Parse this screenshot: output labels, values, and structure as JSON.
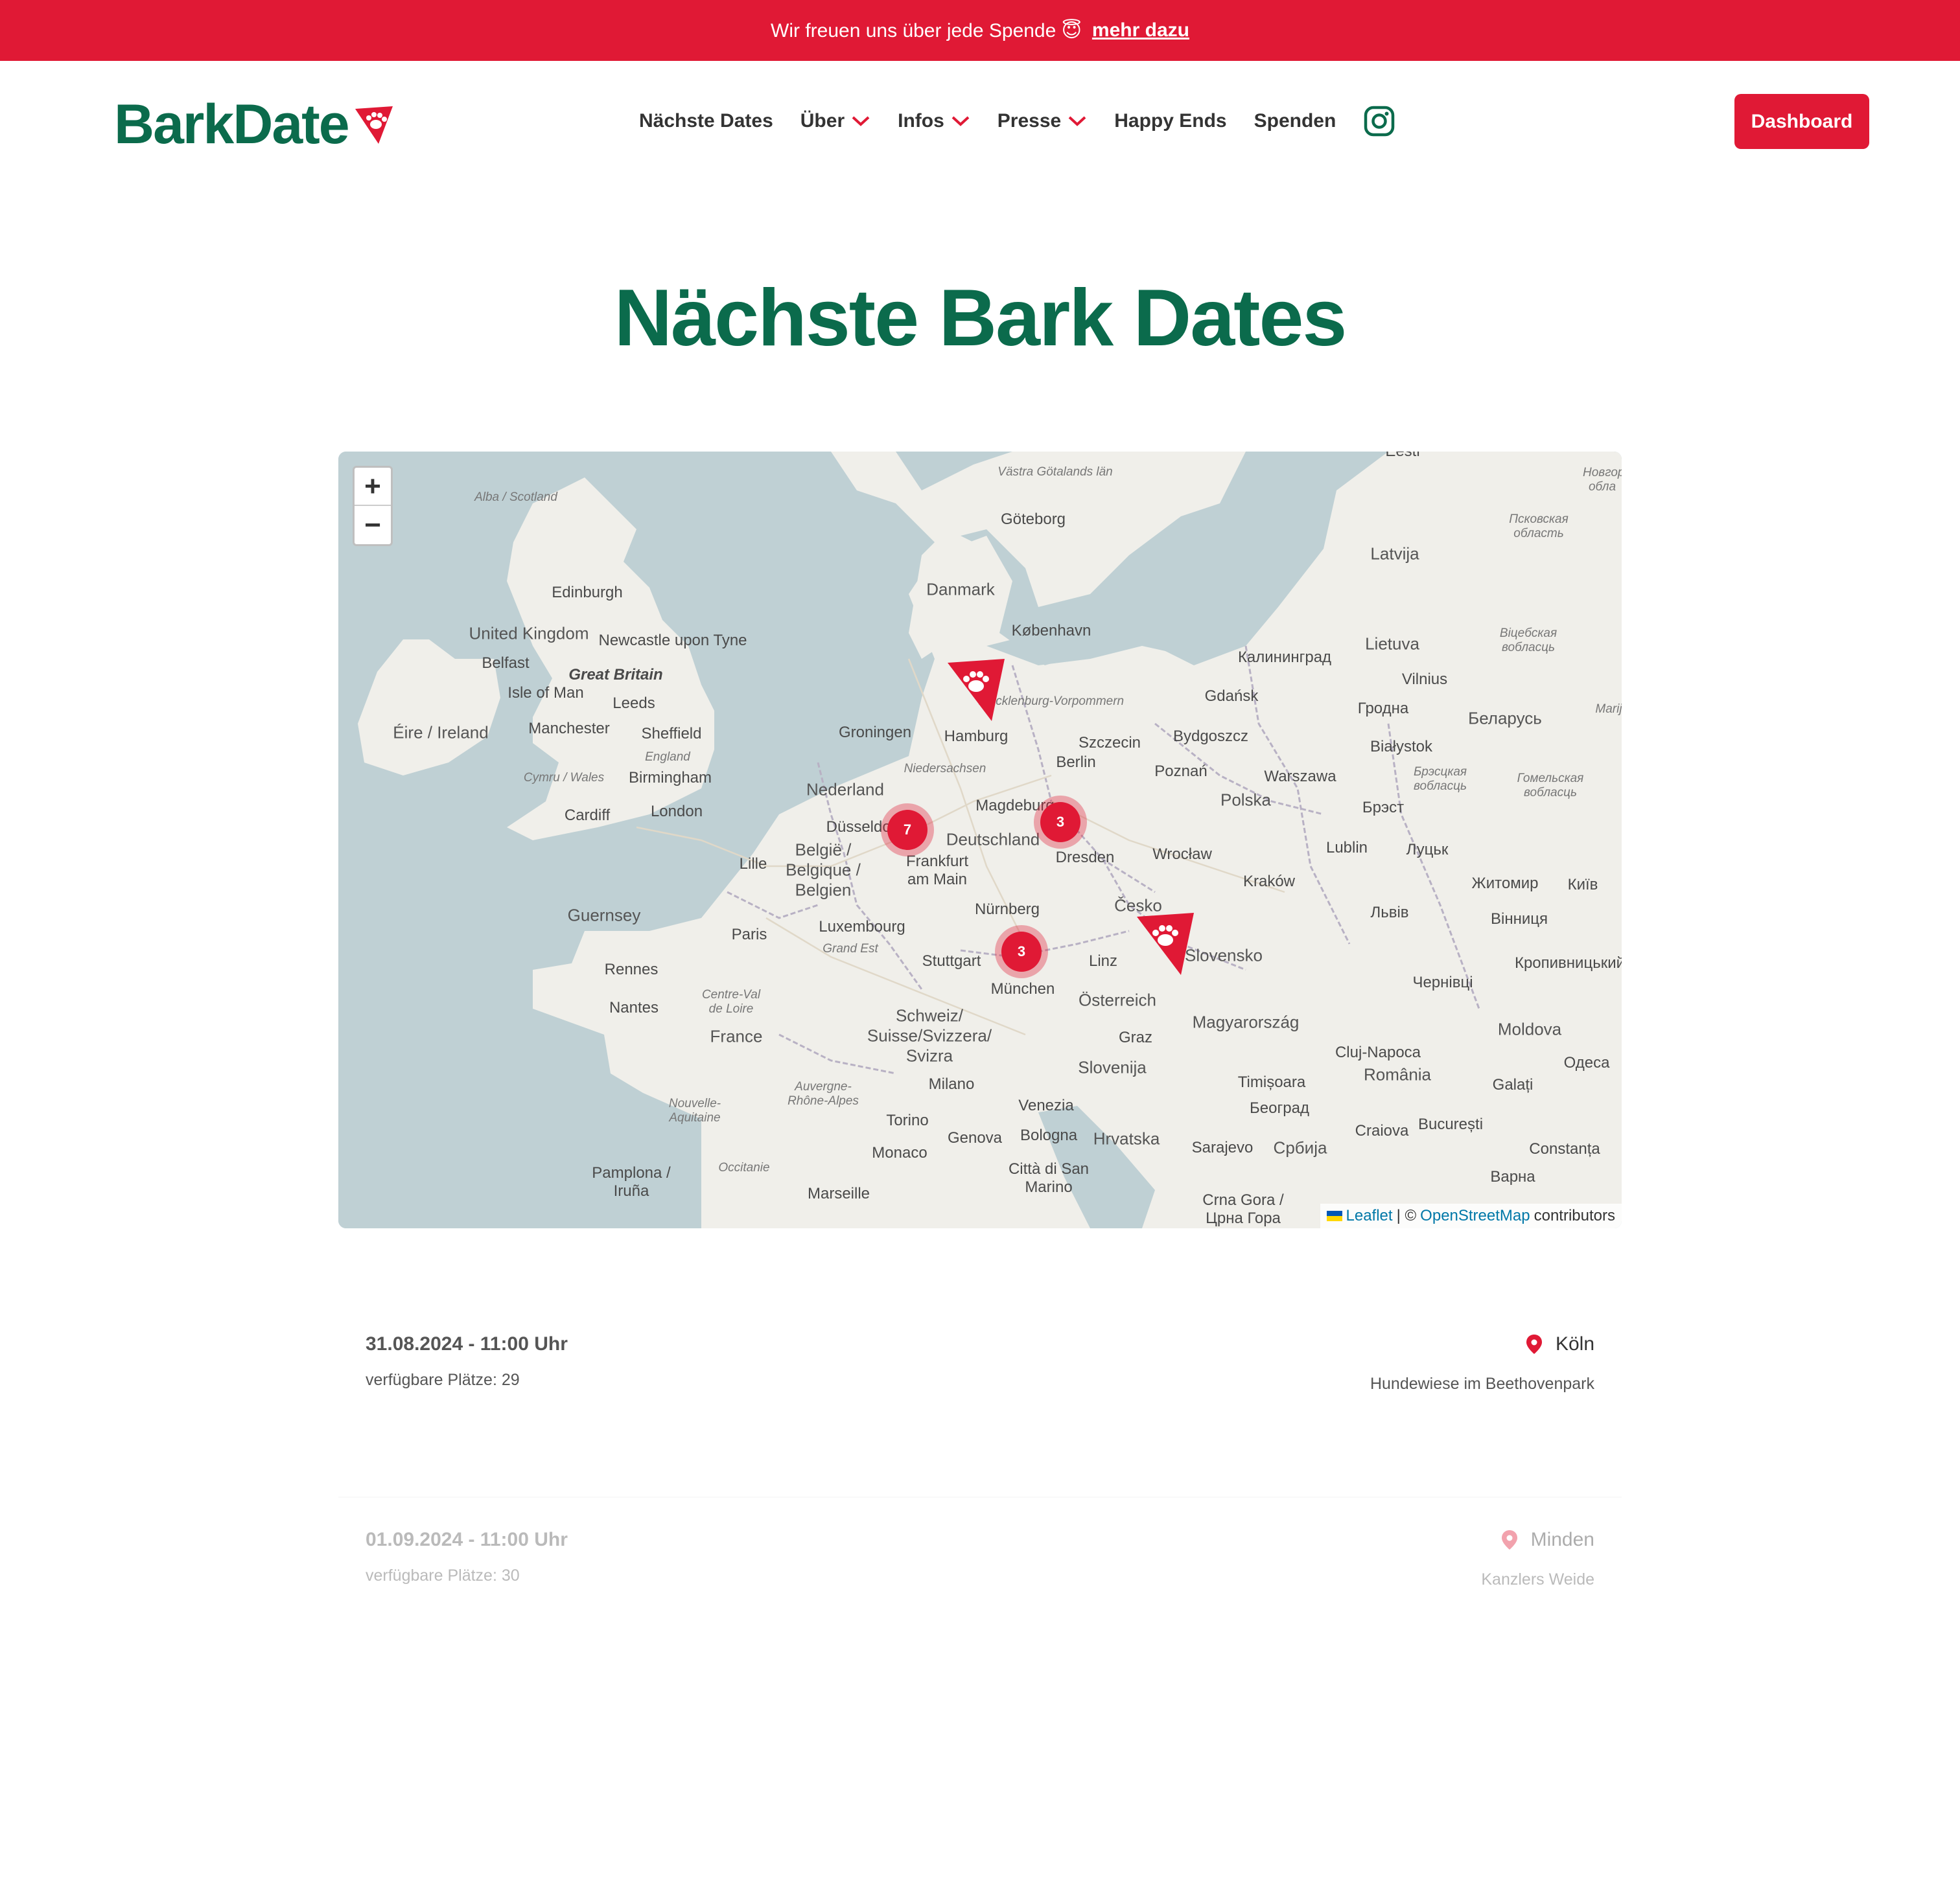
{
  "banner": {
    "text": "Wir freuen uns über jede Spende 😇",
    "link": "mehr dazu"
  },
  "header": {
    "logo": "BarkDate",
    "nav": [
      "Nächste Dates",
      "Über",
      "Infos",
      "Presse",
      "Happy Ends",
      "Spenden"
    ],
    "dashboard": "Dashboard"
  },
  "main": {
    "title": "Nächste Bark Dates"
  },
  "map": {
    "zoom_in": "+",
    "zoom_out": "−",
    "clusters": [
      "7",
      "3",
      "3"
    ],
    "labels": {
      "edinburgh": "Edinburgh",
      "uk": "United Kingdom",
      "newcastle": "Newcastle upon Tyne",
      "belfast": "Belfast",
      "great_britain": "Great Britain",
      "isle_of_man": "Isle of Man",
      "leeds": "Leeds",
      "ireland": "Éire / Ireland",
      "manchester": "Manchester",
      "sheffield": "Sheffield",
      "england": "England",
      "wales": "Cymru / Wales",
      "birmingham": "Birmingham",
      "cardiff": "Cardiff",
      "london": "London",
      "scotland": "Alba / Scotland",
      "danmark": "Danmark",
      "kobenhavn": "København",
      "goteborg": "Göteborg",
      "vastra": "Västra Götalands län",
      "groningen": "Groningen",
      "hamburg": "Hamburg",
      "nederland": "Nederland",
      "niedersachsen": "Niedersachsen",
      "mecklenburg": "Mecklenburg-Vorpommern",
      "berlin": "Berlin",
      "szczecin": "Szczecin",
      "magdeburg": "Magdeburg",
      "deutschland": "Deutschland",
      "dusseldorf": "Düsseldorf",
      "dresden": "Dresden",
      "frankfurt": "Frankfurt am Main",
      "lille": "Lille",
      "belgie": "België / Belgique / Belgien",
      "luxembourg": "Luxembourg",
      "nurnberg": "Nürnberg",
      "stuttgart": "Stuttgart",
      "munchen": "München",
      "paris": "Paris",
      "grand_est": "Grand Est",
      "guernsey": "Guernsey",
      "rennes": "Rennes",
      "nantes": "Nantes",
      "centre": "Centre-Val de Loire",
      "france": "France",
      "schweiz": "Schweiz/ Suisse/Svizzera/ Svizra",
      "auvergne": "Auvergne-Rhône-Alpes",
      "nouvelle": "Nouvelle-Aquitaine",
      "milano": "Milano",
      "torino": "Torino",
      "genova": "Genova",
      "monaco": "Monaco",
      "occitanie": "Occitanie",
      "marseille": "Marseille",
      "pamplona": "Pamplona / Iruña",
      "venezia": "Venezia",
      "bologna": "Bologna",
      "san_marino": "Città di San Marino",
      "osterreich": "Österreich",
      "linz": "Linz",
      "graz": "Graz",
      "slovenija": "Slovenija",
      "hrvatska": "Hrvatska",
      "cesko": "Česko",
      "slovensko": "Slovensko",
      "magyarorszag": "Magyarország",
      "polska": "Polska",
      "poznan": "Poznań",
      "wroclaw": "Wrocław",
      "krakow": "Kraków",
      "warszawa": "Warszawa",
      "gdansk": "Gdańsk",
      "bydgoszcz": "Bydgoszcz",
      "kaliningrad": "Калининград",
      "lietuva": "Lietuva",
      "vilnius": "Vilnius",
      "latvija": "Latvija",
      "bialystok": "Białystok",
      "grodno": "Гродна",
      "belarus": "Беларусь",
      "brest": "Брэст",
      "lublin": "Lublin",
      "lutsk": "Луцьк",
      "lviv": "Львів",
      "zhytomyr": "Житомир",
      "kyiv": "Київ",
      "vinnytsia": "Вінниця",
      "chernivtsi": "Чернівці",
      "kropyvnytskyi": "Кропивницький",
      "moldova": "Moldova",
      "odesa": "Одеса",
      "cluj": "Cluj-Napoca",
      "romania": "România",
      "timisoara": "Timișoara",
      "beograd": "Београд",
      "srbija": "Србија",
      "sarajevo": "Sarajevo",
      "galati": "Galați",
      "bucuresti": "București",
      "craiova": "Craiova",
      "constanta": "Constanța",
      "varna": "Варна",
      "crna_gora": "Crna Gora / Црна Гора",
      "eesti": "Eesti",
      "mari": "Marij",
      "vitebsk": "Віцебская вобласць",
      "homel": "Гомельская вобласць",
      "brest_obl": "Брэсцкая вобласць",
      "pskov": "Псковская область",
      "novgorod": "Новгор обла"
    },
    "attribution": {
      "leaflet": "Leaflet",
      "sep": "| ©",
      "osm": "OpenStreetMap",
      "contrib": "contributors"
    }
  },
  "dates": [
    {
      "when": "31.08.2024 - 11:00 Uhr",
      "places": "verfügbare Plätze: 29",
      "city": "Köln",
      "venue": "Hundewiese im Beethovenpark"
    },
    {
      "when": "01.09.2024 - 11:00 Uhr",
      "places": "verfügbare Plätze: 30",
      "city": "Minden",
      "venue": "Kanzlers Weide"
    }
  ],
  "colors": {
    "brand_red": "#e01935",
    "brand_green": "#0b6b4c"
  },
  "icons": {
    "instagram": "instagram-icon",
    "chevron": "chevron-down-icon",
    "location": "map-pin-icon",
    "paw": "paw-icon"
  }
}
